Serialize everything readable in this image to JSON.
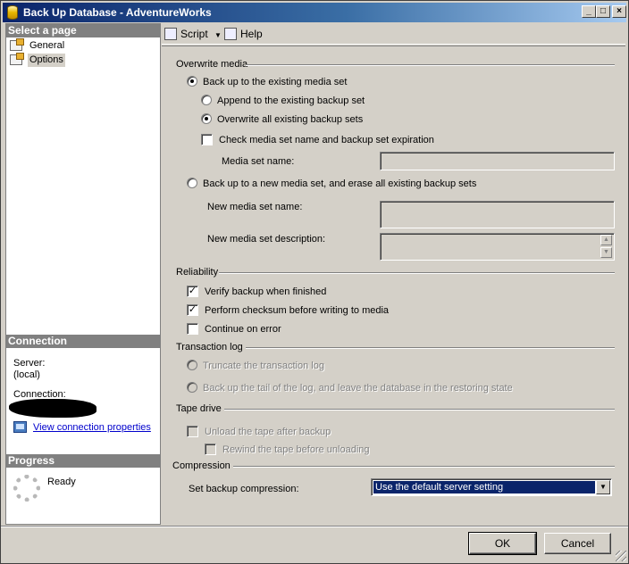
{
  "window": {
    "title": "Back Up Database - AdventureWorks",
    "minimize": "_",
    "maximize": "□",
    "close": "×"
  },
  "left_pane": {
    "select_page_header": "Select a page",
    "pages": [
      {
        "label": "General",
        "selected": false
      },
      {
        "label": "Options",
        "selected": true
      }
    ],
    "connection_header": "Connection",
    "server_label": "Server:",
    "server_value": "(local)",
    "connection_label": "Connection:",
    "view_connection_link": "View connection properties",
    "progress_header": "Progress",
    "progress_status": "Ready"
  },
  "toolbar": {
    "script_label": "Script",
    "help_label": "Help"
  },
  "overwrite_media": {
    "group_label": "Overwrite media",
    "existing_media_radio": {
      "label": "Back up to the existing media set",
      "checked": true
    },
    "append_radio": {
      "label": "Append to the existing backup set",
      "checked": false
    },
    "overwrite_radio": {
      "label": "Overwrite all existing backup sets",
      "checked": true
    },
    "check_media_checkbox": {
      "label": "Check media set name and backup set expiration",
      "checked": false
    },
    "media_set_name_label": "Media set name:",
    "media_set_name_value": "",
    "new_media_radio": {
      "label": "Back up to a new media set, and erase all existing backup sets",
      "checked": false
    },
    "new_media_name_label": "New media set name:",
    "new_media_desc_label": "New media set description:"
  },
  "reliability": {
    "group_label": "Reliability",
    "verify_checkbox": {
      "label": "Verify backup when finished",
      "checked": true
    },
    "checksum_checkbox": {
      "label": "Perform checksum before writing to media",
      "checked": true
    },
    "continue_checkbox": {
      "label": "Continue on error",
      "checked": false
    }
  },
  "transaction_log": {
    "group_label": "Transaction log",
    "truncate_radio": {
      "label": "Truncate the transaction log",
      "enabled": false
    },
    "tail_radio": {
      "label": "Back up the tail of the log, and leave the database in the restoring state",
      "enabled": false
    }
  },
  "tape_drive": {
    "group_label": "Tape drive",
    "unload_checkbox": {
      "label": "Unload the tape after backup",
      "enabled": false
    },
    "rewind_checkbox": {
      "label": "Rewind the tape before unloading",
      "enabled": false
    }
  },
  "compression": {
    "group_label": "Compression",
    "setting_label": "Set backup compression:",
    "selected_value": "Use the default server setting"
  },
  "buttons": {
    "ok": "OK",
    "cancel": "Cancel"
  },
  "colors": {
    "title_bar": "#0a246a",
    "selection": "#0a246a",
    "section_header": "#808080",
    "link": "#0000cc"
  }
}
